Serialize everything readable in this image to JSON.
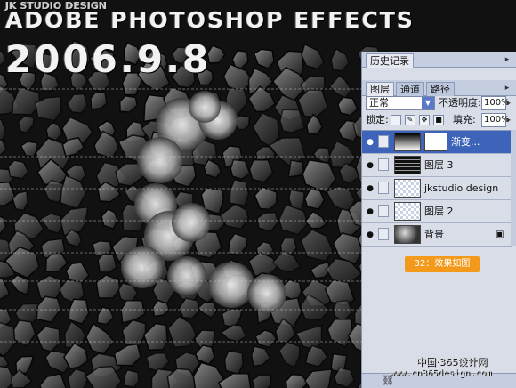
{
  "artwork": {
    "logo_strip": "JK STUDIO DESIGN",
    "headline": "ADOBE PHOTOSHOP EFFECTS",
    "date": "2006.9.8",
    "watermark_line1": "中国·365设计网",
    "watermark_line2": "www.cn365design.com"
  },
  "panel": {
    "history_tab": "历史记录",
    "tabs": [
      "图层",
      "通道",
      "路径"
    ],
    "blend_mode": "正常",
    "opacity_label": "不透明度:",
    "opacity_value": "100%",
    "lock_label": "锁定:",
    "fill_label": "填充:",
    "fill_value": "100%",
    "layers": [
      {
        "name": "渐变...",
        "selected": true,
        "thumb": "gradient"
      },
      {
        "name": "图层 3",
        "selected": false,
        "thumb": "stripes"
      },
      {
        "name": "jkstudio design",
        "selected": false,
        "thumb": "transparent"
      },
      {
        "name": "图层 2",
        "selected": false,
        "thumb": "transparent"
      },
      {
        "name": "背景",
        "selected": false,
        "thumb": "texture"
      }
    ],
    "caption": "32：效果如图"
  },
  "colors": {
    "accent_orange": "#f39a1c",
    "selection_blue": "#3d64b8",
    "panel_bg": "#d8dde8"
  }
}
